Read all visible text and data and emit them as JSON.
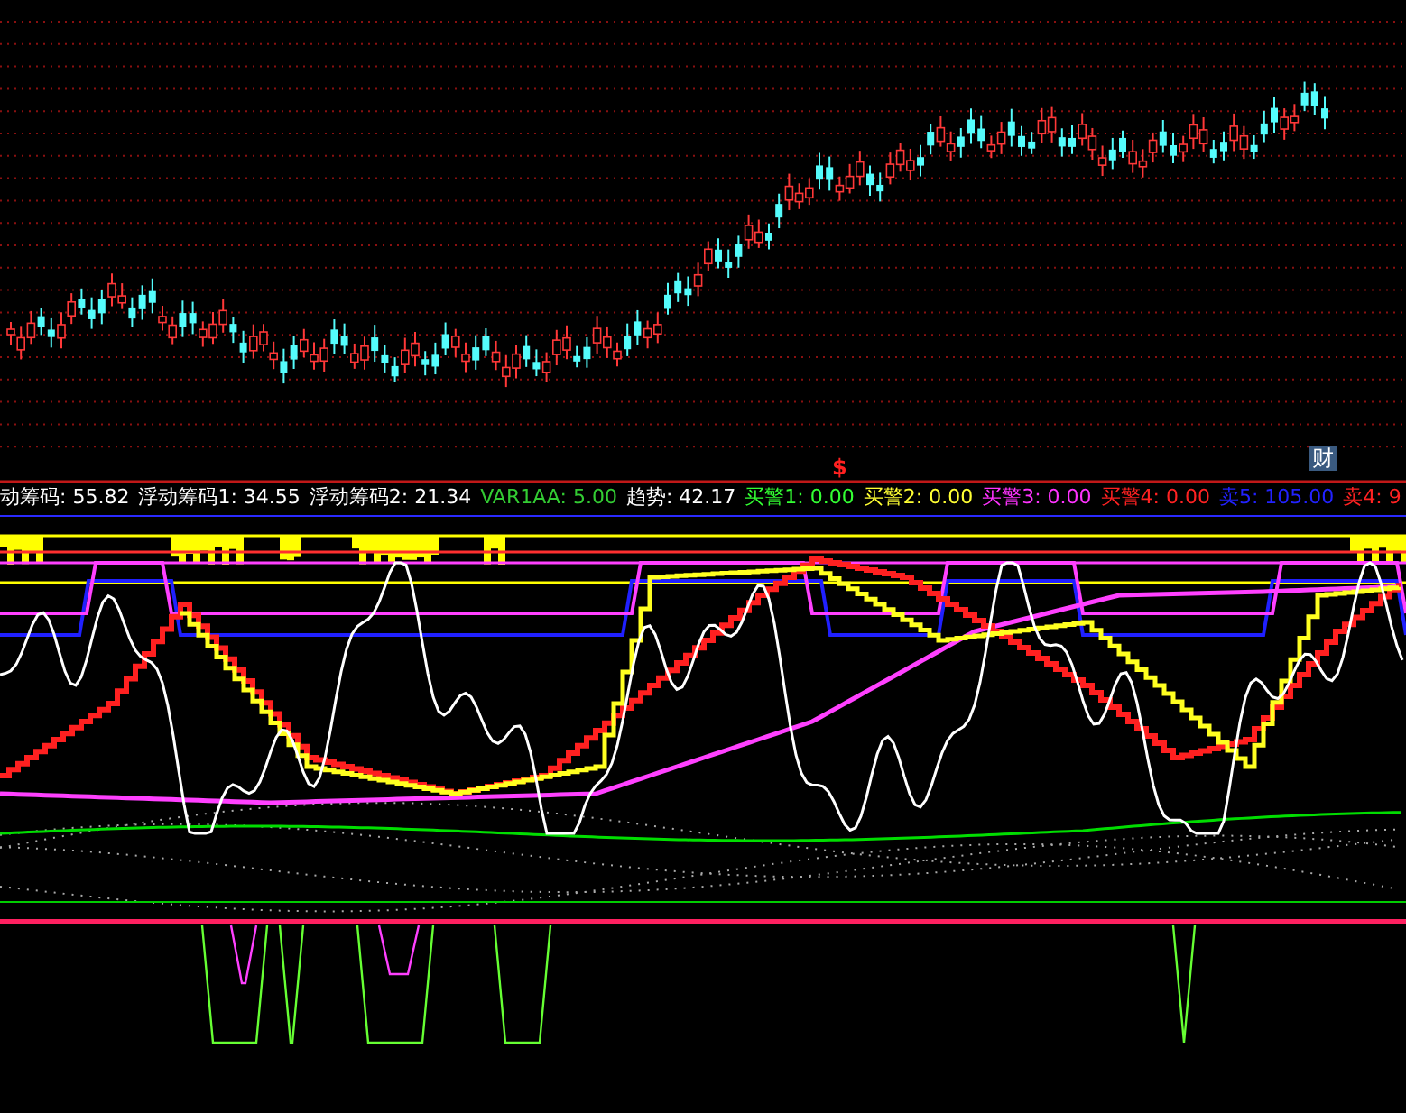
{
  "price_panel": {
    "markers": [
      {
        "kind": "signal",
        "text": "$"
      },
      {
        "kind": "badge",
        "text": "财"
      }
    ]
  },
  "indicator_panel": {
    "legend": [
      {
        "text": "动筹码: 55.82",
        "color": "#ffffff"
      },
      {
        "text": "浮动筹码1: 34.55",
        "color": "#ffffff"
      },
      {
        "text": "浮动筹码2: 21.34",
        "color": "#ffffff"
      },
      {
        "text": "VAR1AA: 5.00",
        "color": "#33cc33"
      },
      {
        "text": "趋势: 42.17",
        "color": "#ffffff"
      },
      {
        "text": "买警1: 0.00",
        "color": "#33ff33"
      },
      {
        "text": "买警2: 0.00",
        "color": "#ffff33"
      },
      {
        "text": "买警3: 0.00",
        "color": "#ff33ff"
      },
      {
        "text": "买警4: 0.00",
        "color": "#ff2222"
      },
      {
        "text": "卖5: 105.00",
        "color": "#2222ff"
      },
      {
        "text": "卖4: 9",
        "color": "#ff2222"
      }
    ]
  }
}
